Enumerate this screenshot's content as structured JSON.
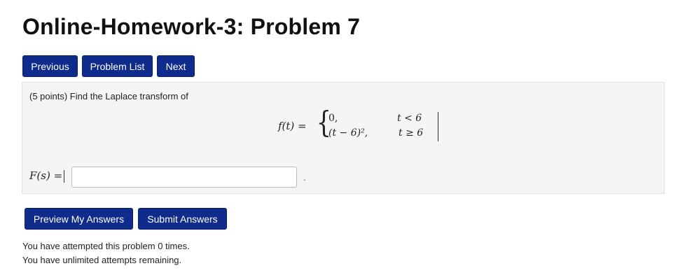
{
  "page": {
    "title": "Online-Homework-3: Problem 7"
  },
  "nav": {
    "previous": "Previous",
    "problem_list": "Problem List",
    "next": "Next"
  },
  "problem": {
    "prompt": "(5 points) Find the Laplace transform of",
    "function": {
      "lhs": "f(t) =",
      "case1_value": "0,",
      "case1_condition": "t < 6",
      "case2_value": "(t − 6)²,",
      "case2_condition": "t ≥ 6"
    },
    "answer": {
      "label": "F(s) =",
      "value": "",
      "trailing": "."
    }
  },
  "actions": {
    "preview": "Preview My Answers",
    "submit": "Submit Answers"
  },
  "status": {
    "attempts_line": "You have attempted this problem 0 times.",
    "remaining_line": "You have unlimited attempts remaining."
  },
  "colors": {
    "button_bg": "#0f2b8c",
    "panel_bg": "#f5f5f5"
  }
}
